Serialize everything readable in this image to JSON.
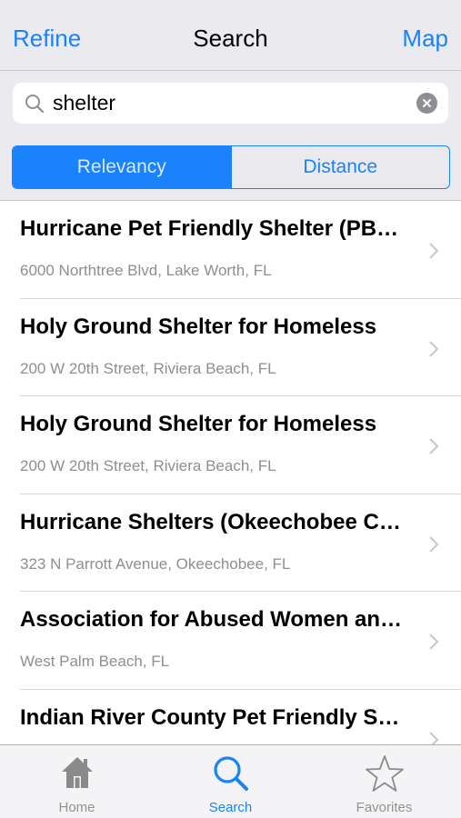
{
  "navbar": {
    "left_label": "Refine",
    "title": "Search",
    "right_label": "Map"
  },
  "search": {
    "value": "shelter",
    "placeholder": "",
    "icon": "search-icon",
    "clear_icon": "clear-icon"
  },
  "sort": {
    "options": [
      "Relevancy",
      "Distance"
    ],
    "selected": "Relevancy"
  },
  "results": [
    {
      "title": "Hurricane Pet Friendly Shelter (PB…",
      "subtitle": "6000 Northtree Blvd, Lake Worth, FL"
    },
    {
      "title": "Holy Ground Shelter for Homeless",
      "subtitle": "200 W 20th Street, Riviera Beach, FL"
    },
    {
      "title": "Holy Ground Shelter for Homeless",
      "subtitle": "200 W 20th Street, Riviera Beach, FL"
    },
    {
      "title": "Hurricane Shelters (Okeechobee C…",
      "subtitle": "323 N Parrott Avenue, Okeechobee, FL"
    },
    {
      "title": "Association for Abused Women an…",
      "subtitle": "West Palm Beach, FL"
    },
    {
      "title": "Indian River County Pet Friendly S…",
      "subtitle": ""
    }
  ],
  "tabbar": {
    "tabs": [
      {
        "label": "Home",
        "icon": "house-icon",
        "active": false
      },
      {
        "label": "Search",
        "icon": "search-icon",
        "active": true
      },
      {
        "label": "Favorites",
        "icon": "star-icon",
        "active": false
      }
    ]
  },
  "colors": {
    "accent": "#1a82fb",
    "header_bg": "#ebebef",
    "subtitle_gray": "#8e8e93",
    "tab_inactive": "#929292"
  }
}
